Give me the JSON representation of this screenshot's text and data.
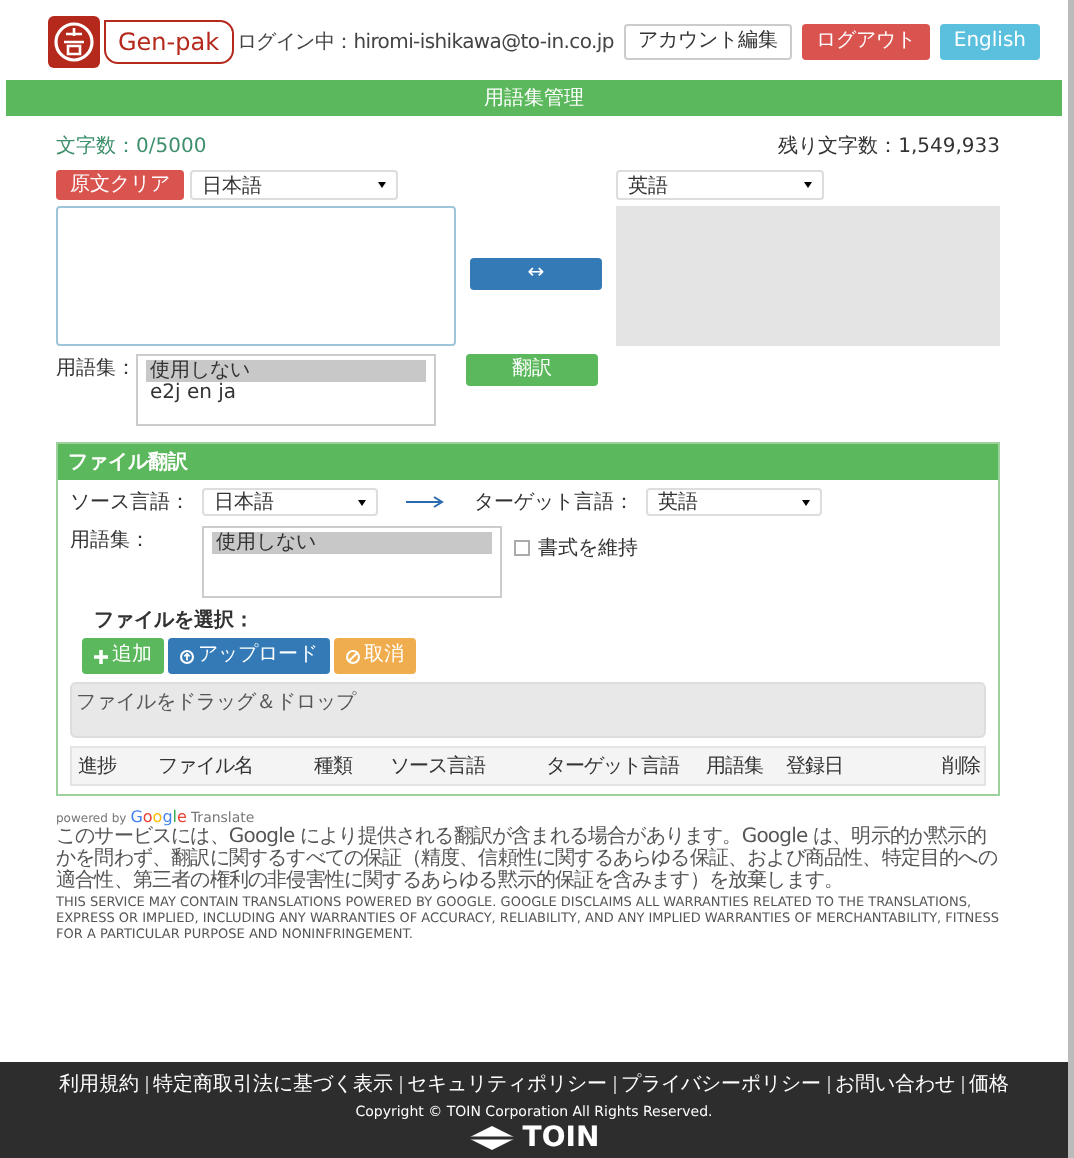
{
  "header": {
    "logo_text": "Gen-pak",
    "login_label": "ログイン中：hiromi-ishikawa@to-in.co.jp",
    "buttons": [
      {
        "label": "アカウント編集",
        "kind": "default"
      },
      {
        "label": "ログアウト",
        "kind": "danger"
      },
      {
        "label": "English",
        "kind": "info"
      }
    ]
  },
  "title_bar": "用語集管理",
  "char_count": "文字数：0/5000",
  "remaining": "残り文字数：1,549,933",
  "translate": {
    "clear_button": "原文クリア",
    "source_select": "日本語",
    "target_select": "英語",
    "swap_button": "↔",
    "translate_button": "翻訳",
    "glossary_label": "用語集：",
    "glossary_options": [
      {
        "label": "使用しない",
        "selected": true
      },
      {
        "label": "e2j en ja",
        "selected": false
      }
    ]
  },
  "file_panel": {
    "title": "ファイル翻訳",
    "source_label": "ソース言語：",
    "source_select": "日本語",
    "target_label": "ターゲット言語：",
    "target_select": "英語",
    "glossary_label": "用語集：",
    "glossary_options": [
      {
        "label": "使用しない",
        "selected": true
      }
    ],
    "keep_format": {
      "label": "書式を維持",
      "checked": false
    },
    "file_label": "ファイルを選択：",
    "buttons": [
      {
        "label": "追加",
        "kind": "success"
      },
      {
        "label": "アップロード",
        "kind": "primary"
      },
      {
        "label": "取消",
        "kind": "warning"
      }
    ],
    "dropzone": "ファイルをドラッグ＆ドロップ",
    "columns": [
      "進捗",
      "ファイル名",
      "種類",
      "ソース言語",
      "ターゲット言語",
      "用語集",
      "登録日",
      "削除"
    ]
  },
  "powered_by": "powered by",
  "google": "Google",
  "google_translate": "Translate",
  "disclaimer_ja": "このサービスには、Google により提供される翻訳が含まれる場合があります。Google は、明示的か黙示的かを問わず、翻訳に関するすべての保証（精度、信頼性に関するあらゆる保証、および商品性、特定目的への適合性、第三者の権利の非侵害性に関するあらゆる黙示的保証を含みます）を放棄します。",
  "disclaimer_en": "THIS SERVICE MAY CONTAIN TRANSLATIONS POWERED BY GOOGLE. GOOGLE DISCLAIMS ALL WARRANTIES RELATED TO THE TRANSLATIONS, EXPRESS OR IMPLIED, INCLUDING ANY WARRANTIES OF ACCURACY, RELIABILITY, AND ANY IMPLIED WARRANTIES OF MERCHANTABILITY, FITNESS FOR A PARTICULAR PURPOSE AND NONINFRINGEMENT.",
  "footer": {
    "links": [
      "利用規約",
      "特定商取引法に基づく表示",
      "セキュリティポリシー",
      "プライバシーポリシー",
      "お問い合わせ",
      "価格"
    ],
    "copyright": "Copyright © TOIN Corporation All Rights Reserved.",
    "brand": "TOIN"
  }
}
